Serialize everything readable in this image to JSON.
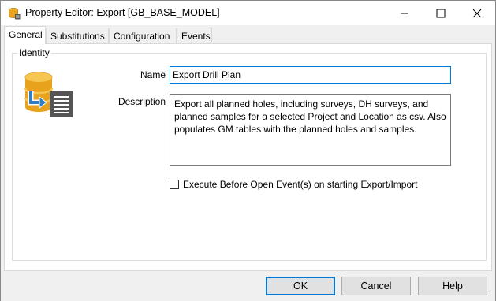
{
  "window": {
    "title": "Property Editor: Export [GB_BASE_MODEL]",
    "icon": "database-icon"
  },
  "tabs": [
    {
      "label": "General",
      "active": true
    },
    {
      "label": "Substitutions",
      "active": false
    },
    {
      "label": "Configuration",
      "active": false
    },
    {
      "label": "Events",
      "active": false
    }
  ],
  "identity": {
    "group_label": "Identity",
    "icon": "database-export-icon",
    "name_label": "Name",
    "name_value": "Export Drill Plan",
    "description_label": "Description",
    "description_value": "Export all planned holes, including surveys, DH surveys, and planned samples for a selected Project and Location as csv. Also populates GM tables with the planned holes and samples.",
    "execute_checkbox_label": "Execute Before Open Event(s) on starting Export/Import",
    "execute_checked": false
  },
  "buttons": {
    "ok": "OK",
    "cancel": "Cancel",
    "help": "Help"
  },
  "colors": {
    "accent": "#0078d7",
    "db_gold": "#e8a21c",
    "arrow_blue": "#2f7fc1"
  }
}
